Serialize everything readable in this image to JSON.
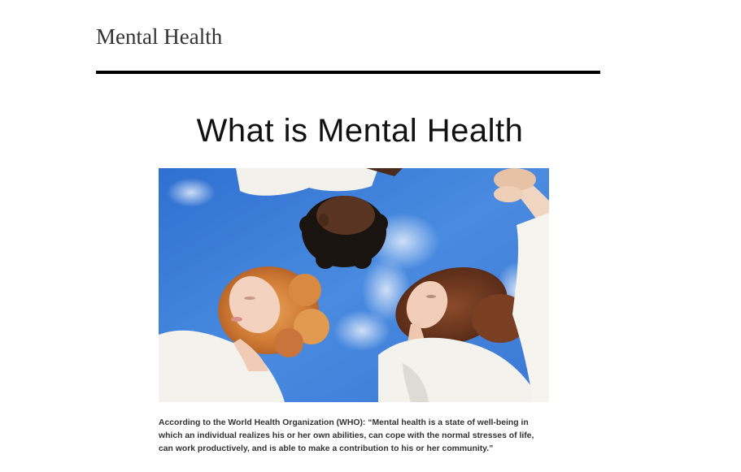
{
  "site": {
    "title": "Mental Health"
  },
  "main": {
    "heading": "What is Mental Health",
    "hero_image": {
      "alt": "Three people in white shirts viewed from below against a blue sky"
    },
    "paragraph": "According to the World Health Organization (WHO): “Mental health is a state of well-being in which an individual realizes his or her own abilities, can cope with the normal stresses of life, can work productively, and is able to make a contribution to his or her community.”"
  },
  "colors": {
    "page_background": "#ffffff",
    "header_rule": "#000000",
    "text": "#333333",
    "sky": "#3f7fd6"
  }
}
